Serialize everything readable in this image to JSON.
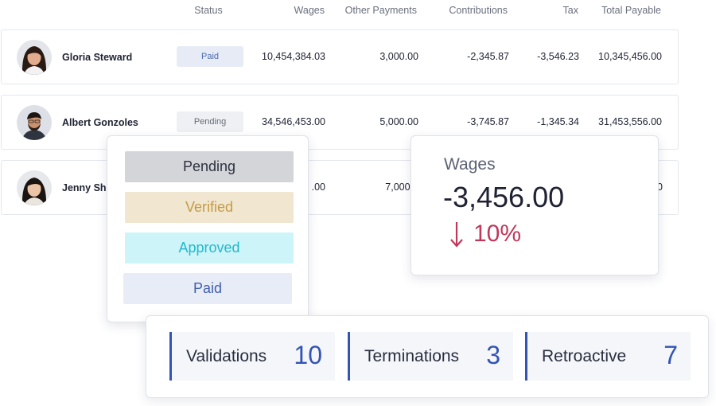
{
  "headers": {
    "status": "Status",
    "wages": "Wages",
    "other_payments": "Other Payments",
    "contributions": "Contributions",
    "tax": "Tax",
    "total_payable": "Total Payable"
  },
  "rows": [
    {
      "name": "Gloria Steward",
      "status": "Paid",
      "wages": "10,454,384.03",
      "other_payments": "3,000.00",
      "contributions": "-2,345.87",
      "tax": "-3,546.23",
      "total_payable": "10,345,456.00"
    },
    {
      "name": "Albert Gonzoles",
      "status": "Pending",
      "wages": "34,546,453.00",
      "other_payments": "5,000.00",
      "contributions": "-3,745.87",
      "tax": "-1,345.34",
      "total_payable": "31,453,556.00"
    },
    {
      "name": "Jenny Shir",
      "wages": ".00",
      "other_payments": "7,000.0",
      "total_payable": "0"
    }
  ],
  "status_options": [
    "Pending",
    "Verified",
    "Approved",
    "Paid"
  ],
  "wages_card": {
    "title": "Wages",
    "value": "-3,456.00",
    "change": "10%",
    "change_direction": "down",
    "change_color": "#c0385a"
  },
  "stats": [
    {
      "label": "Validations",
      "value": "10"
    },
    {
      "label": "Terminations",
      "value": "3"
    },
    {
      "label": "Retroactive",
      "value": "7"
    }
  ],
  "colors": {
    "accent": "#3454b4",
    "paid_badge_bg": "#e6ebf6",
    "pending_badge_bg": "#eef0f3",
    "verified_bg": "#f1e6cf",
    "approved_bg": "#cdf4f8"
  }
}
